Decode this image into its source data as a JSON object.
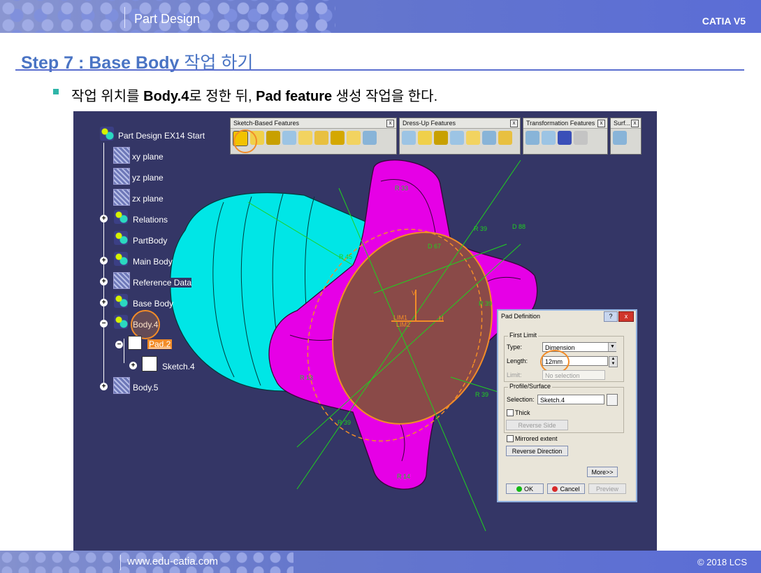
{
  "header": {
    "title": "Part Design",
    "brand": "CATIA V5"
  },
  "step": {
    "prefix": "Step 7 : Base Body",
    "suffix": "작업 하기"
  },
  "instruction": {
    "p1": "작업 위치를",
    "b1": "Body.4",
    "p2": "로 정한 뒤,",
    "b2": "Pad feature",
    "p3": "생성 작업을 한다."
  },
  "tree": {
    "root": "Part Design EX14 Start",
    "items": [
      "xy plane",
      "yz plane",
      "zx plane",
      "Relations",
      "PartBody",
      "Main Body",
      "Reference Data",
      "Base Body",
      "Body.4",
      "Pad.2",
      "Sketch.4",
      "Body.5"
    ]
  },
  "toolbars": [
    {
      "title": "Sketch-Based Features",
      "close": "x"
    },
    {
      "title": "Dress-Up Features",
      "close": "x"
    },
    {
      "title": "Transformation Features",
      "close": "x"
    },
    {
      "title": "Surf...",
      "close": "x"
    }
  ],
  "model_labels": [
    "R 33",
    "R 39",
    "D 88",
    "D 67",
    "R 45",
    "R 39",
    "R 39",
    "R 13",
    "R 39",
    "R 14",
    "LIM1",
    "LIM2",
    "V",
    "H"
  ],
  "dialog": {
    "title": "Pad Definition",
    "help": "?",
    "close": "x",
    "first_limit": "First Limit",
    "type_label": "Type:",
    "type_value": "Dimension",
    "length_label": "Length:",
    "length_value": "12mm",
    "limit_label": "Limit:",
    "limit_value": "No selection",
    "profile": "Profile/Surface",
    "selection_label": "Selection:",
    "selection_value": "Sketch.4",
    "thick": "Thick",
    "reverse_side": "Reverse Side",
    "mirrored": "Mirrored extent",
    "reverse_direction": "Reverse Direction",
    "more": "More>>",
    "ok": "OK",
    "cancel": "Cancel",
    "preview": "Preview"
  },
  "footer": {
    "site": "www.edu-catia.com",
    "copyright": "© 2018 LCS"
  },
  "colors": {
    "banner": "#6577cc",
    "step_title": "#4a74c4",
    "viewport": "#343666",
    "part_magenta": "#e600e6",
    "part_cyan": "#00e6e6",
    "highlight": "#f28c28"
  }
}
